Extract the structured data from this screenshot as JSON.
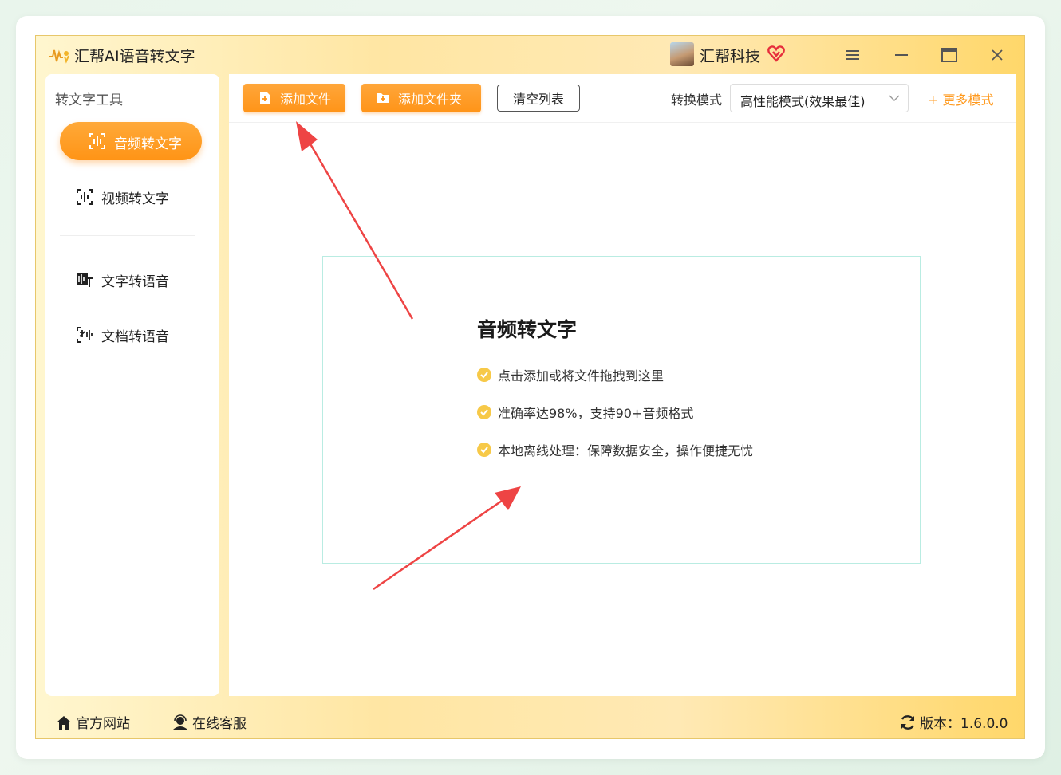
{
  "window": {
    "title": "汇帮AI语音转文字",
    "user_name": "汇帮科技"
  },
  "sidebar": {
    "heading": "转文字工具",
    "items": [
      {
        "label": "音频转文字",
        "active": true
      },
      {
        "label": "视频转文字",
        "active": false
      },
      {
        "label": "文字转语音",
        "active": false
      },
      {
        "label": "文档转语音",
        "active": false
      }
    ]
  },
  "toolbar": {
    "add_file": "添加文件",
    "add_folder": "添加文件夹",
    "clear_list": "清空列表",
    "mode_label": "转换模式",
    "mode_value": "高性能模式(效果最佳)",
    "more_modes": "+ 更多模式"
  },
  "dropzone": {
    "title": "音频转文字",
    "features": [
      "点击添加或将文件拖拽到这里",
      "准确率达98%，支持90+音频格式",
      "本地离线处理：保障数据安全，操作便捷无忧"
    ]
  },
  "footer": {
    "website": "官方网站",
    "support": "在线客服",
    "version": "版本：1.6.0.0"
  },
  "colors": {
    "accent": "#ff9a1f",
    "arrow": "#ee4444",
    "check": "#f7c948",
    "dropzone_border": "#b9ece2"
  }
}
